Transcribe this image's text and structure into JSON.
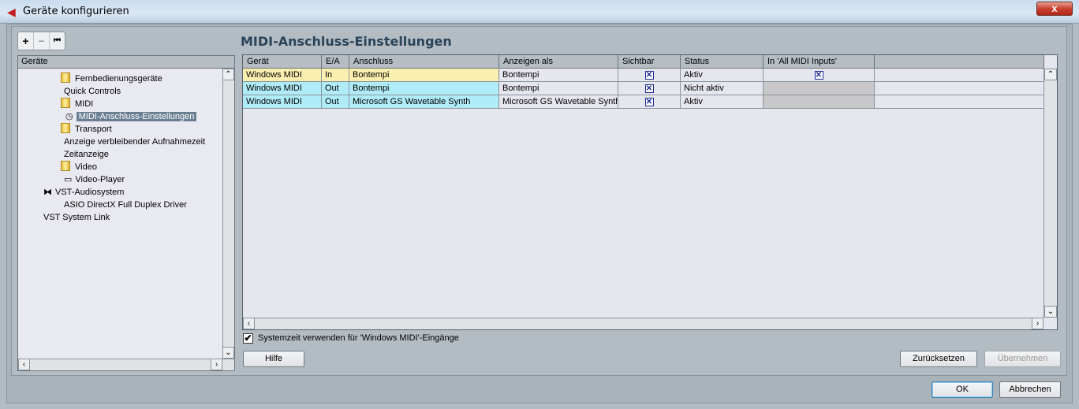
{
  "window": {
    "title": "Geräte konfigurieren",
    "close": "x"
  },
  "toolbar": {
    "add": "+",
    "remove": "−",
    "reset": "⏮"
  },
  "tree": {
    "header": "Geräte",
    "nodes": [
      {
        "label": "Fernbedienungsgeräte"
      },
      {
        "label": "Quick Controls"
      },
      {
        "label": "MIDI"
      },
      {
        "label": "MIDI-Anschluss-Einstellungen"
      },
      {
        "label": "Transport"
      },
      {
        "label": "Anzeige verbleibender Aufnahmezeit"
      },
      {
        "label": "Zeitanzeige"
      },
      {
        "label": "Video"
      },
      {
        "label": "Video-Player"
      },
      {
        "label": "VST-Audiosystem"
      },
      {
        "label": "ASIO DirectX Full Duplex Driver"
      },
      {
        "label": "VST System Link"
      }
    ]
  },
  "main": {
    "title": "MIDI-Anschluss-Einstellungen",
    "columns": [
      "Gerät",
      "E/A",
      "Anschluss",
      "Anzeigen als",
      "Sichtbar",
      "Status",
      "In 'All MIDI Inputs'"
    ],
    "rows": [
      {
        "device": "Windows MIDI",
        "io": "In",
        "port": "Bontempi",
        "show_as": "Bontempi",
        "visible": true,
        "status": "Aktiv",
        "all_inputs": true
      },
      {
        "device": "Windows MIDI",
        "io": "Out",
        "port": "Bontempi",
        "show_as": "Bontempi",
        "visible": true,
        "status": "Nicht aktiv",
        "all_inputs": null
      },
      {
        "device": "Windows MIDI",
        "io": "Out",
        "port": "Microsoft GS Wavetable Synth",
        "show_as": "Microsoft GS Wavetable Synth",
        "visible": true,
        "status": "Aktiv",
        "all_inputs": null
      }
    ],
    "systime_label": "Systemzeit verwenden für 'Windows MIDI'-Eingänge",
    "systime_checked": true
  },
  "buttons": {
    "help": "Hilfe",
    "reset": "Zurücksetzen",
    "apply": "Übernehmen",
    "ok": "OK",
    "cancel": "Abbrechen"
  },
  "colors": {
    "in_row": "#fbefb0",
    "out_row": "#b0ecf8"
  }
}
